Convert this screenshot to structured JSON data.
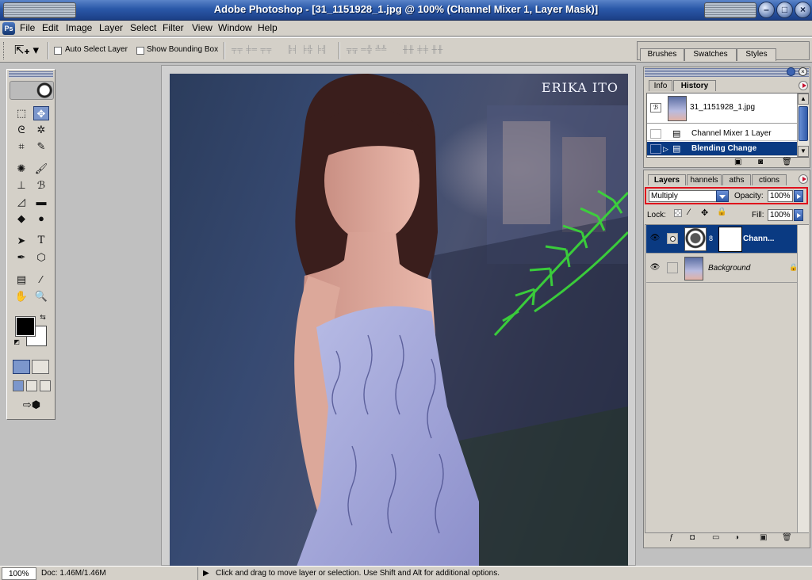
{
  "window": {
    "title": "Adobe Photoshop - [31_1151928_1.jpg @ 100% (Channel Mixer 1, Layer Mask)]",
    "app_icon": "photoshop-icon"
  },
  "menu": {
    "items": [
      {
        "label": "File"
      },
      {
        "label": "Edit"
      },
      {
        "label": "Image"
      },
      {
        "label": "Layer"
      },
      {
        "label": "Select"
      },
      {
        "label": "Filter"
      },
      {
        "label": "View"
      },
      {
        "label": "Window"
      },
      {
        "label": "Help"
      }
    ]
  },
  "options": {
    "auto_select_label": "Auto Select Layer",
    "show_bounding_label": "Show Bounding Box",
    "palette_well_tabs": [
      "Brushes",
      "Swatches",
      "Styles"
    ]
  },
  "canvas": {
    "watermark": "ERIKA ITO"
  },
  "history_panel": {
    "tabs": [
      "Info",
      "History"
    ],
    "active_tab": "History",
    "snapshot": "31_1151928_1.jpg",
    "states": [
      {
        "label": "Channel Mixer 1 Layer",
        "selected": false
      },
      {
        "label": "Blending Change",
        "selected": true
      }
    ]
  },
  "layers_panel": {
    "tabs": [
      "Layers",
      "Channels",
      "Paths",
      "Actions"
    ],
    "visible_tabs": [
      "Layers",
      "hannels",
      "aths",
      "ctions"
    ],
    "blend_mode": "Multiply",
    "opacity_label": "Opacity:",
    "opacity": "100%",
    "lock_label": "Lock:",
    "fill_label": "Fill:",
    "fill": "100%",
    "layers": [
      {
        "name": "Chann...",
        "selected": true
      },
      {
        "name": "Background",
        "selected": false
      }
    ]
  },
  "status": {
    "zoom": "100%",
    "doc": "Doc: 1.46M/1.46M",
    "hint": "Click and drag to move layer or selection.  Use Shift and Alt for additional options."
  },
  "colors": {
    "title_bar": "#2a58a8",
    "selection": "#0a3a82",
    "highlight_box": "#e0101c"
  }
}
